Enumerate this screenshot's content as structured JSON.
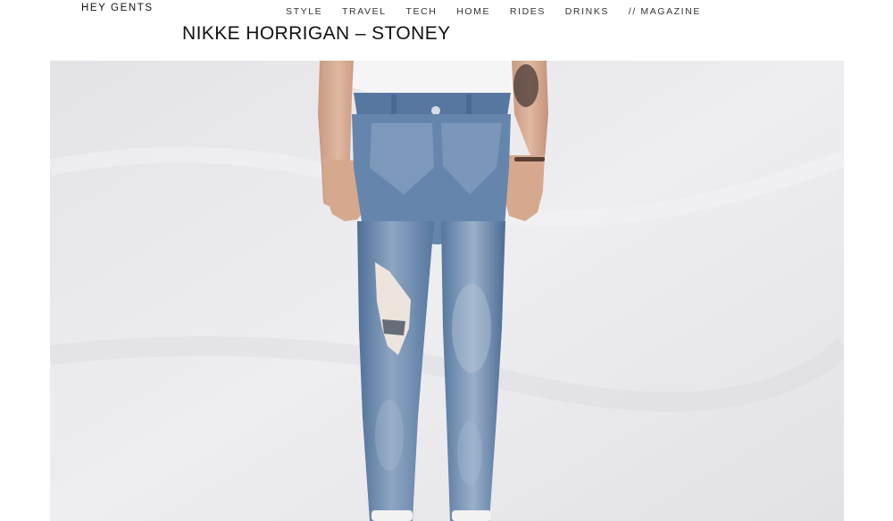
{
  "site": {
    "logo": "HEY GENTS"
  },
  "nav": {
    "items": [
      {
        "label": "STYLE"
      },
      {
        "label": "TRAVEL"
      },
      {
        "label": "TECH"
      },
      {
        "label": "HOME"
      },
      {
        "label": "RIDES"
      },
      {
        "label": "DRINKS"
      },
      {
        "label": "// MAGAZINE"
      }
    ]
  },
  "post": {
    "title": "NIKKE HORRIGAN – STONEY"
  },
  "colors": {
    "background": "#ffffff",
    "text": "#1a1a1a",
    "hero_backdrop": "#e9e9ec",
    "denim": "#5f7fa8",
    "denim_light": "#9fb4cc",
    "shirt": "#f4f4f4",
    "skin": "#d8ad93"
  },
  "hero": {
    "subject": "model-jeans-photo"
  }
}
